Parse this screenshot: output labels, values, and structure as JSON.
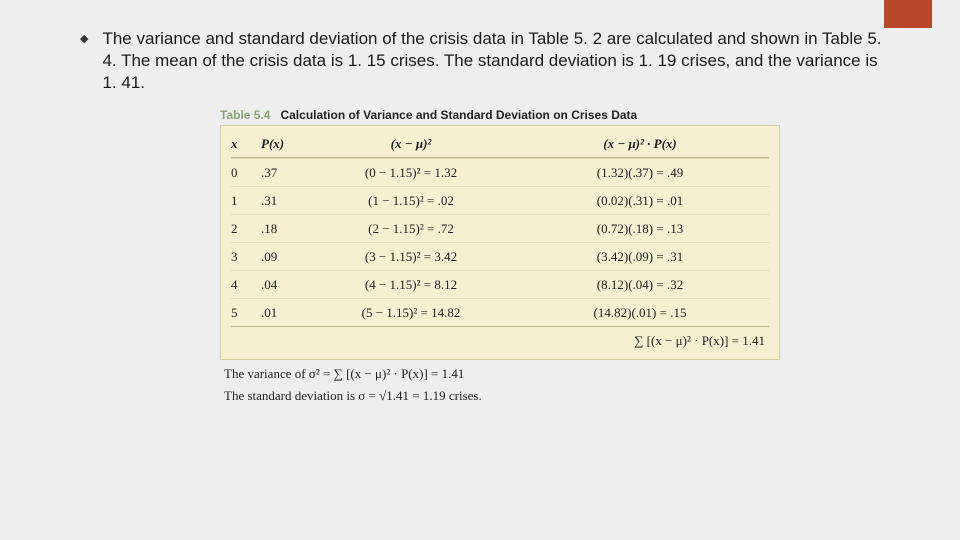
{
  "accent": {
    "color": "#b7472a"
  },
  "bullet": {
    "text": "The variance and standard deviation of the crisis data in Table 5. 2 are calculated and shown in Table 5. 4. The mean of the crisis data is 1. 15 crises. The standard deviation is 1. 19 crises, and the variance is 1. 41."
  },
  "table": {
    "label": "Table 5.4",
    "title": "Calculation of Variance and Standard Deviation on Crises Data",
    "headers": {
      "x": "x",
      "px": "P(x)",
      "sq": "(x − μ)²",
      "prod": "(x − μ)² · P(x)"
    },
    "rows": [
      {
        "x": "0",
        "px": ".37",
        "sq": "(0 − 1.15)² = 1.32",
        "prod": "(1.32)(.37) = .49"
      },
      {
        "x": "1",
        "px": ".31",
        "sq": "(1 − 1.15)² =  .02",
        "prod": "(0.02)(.31) = .01"
      },
      {
        "x": "2",
        "px": ".18",
        "sq": "(2 − 1.15)² =  .72",
        "prod": "(0.72)(.18) = .13"
      },
      {
        "x": "3",
        "px": ".09",
        "sq": "(3 − 1.15)² = 3.42",
        "prod": "(3.42)(.09) = .31"
      },
      {
        "x": "4",
        "px": ".04",
        "sq": "(4 − 1.15)² = 8.12",
        "prod": "(8.12)(.04) = .32"
      },
      {
        "x": "5",
        "px": ".01",
        "sq": "(5 − 1.15)² = 14.82",
        "prod": "(14.82)(.01) = .15"
      }
    ],
    "sum": "∑ [(x − μ)² · P(x)] = 1.41",
    "footer": {
      "variance": "The variance of  σ² = ∑ [(x − μ)² · P(x)] = 1.41",
      "stddev": "The standard deviation is  σ = √1.41 = 1.19 crises."
    }
  }
}
